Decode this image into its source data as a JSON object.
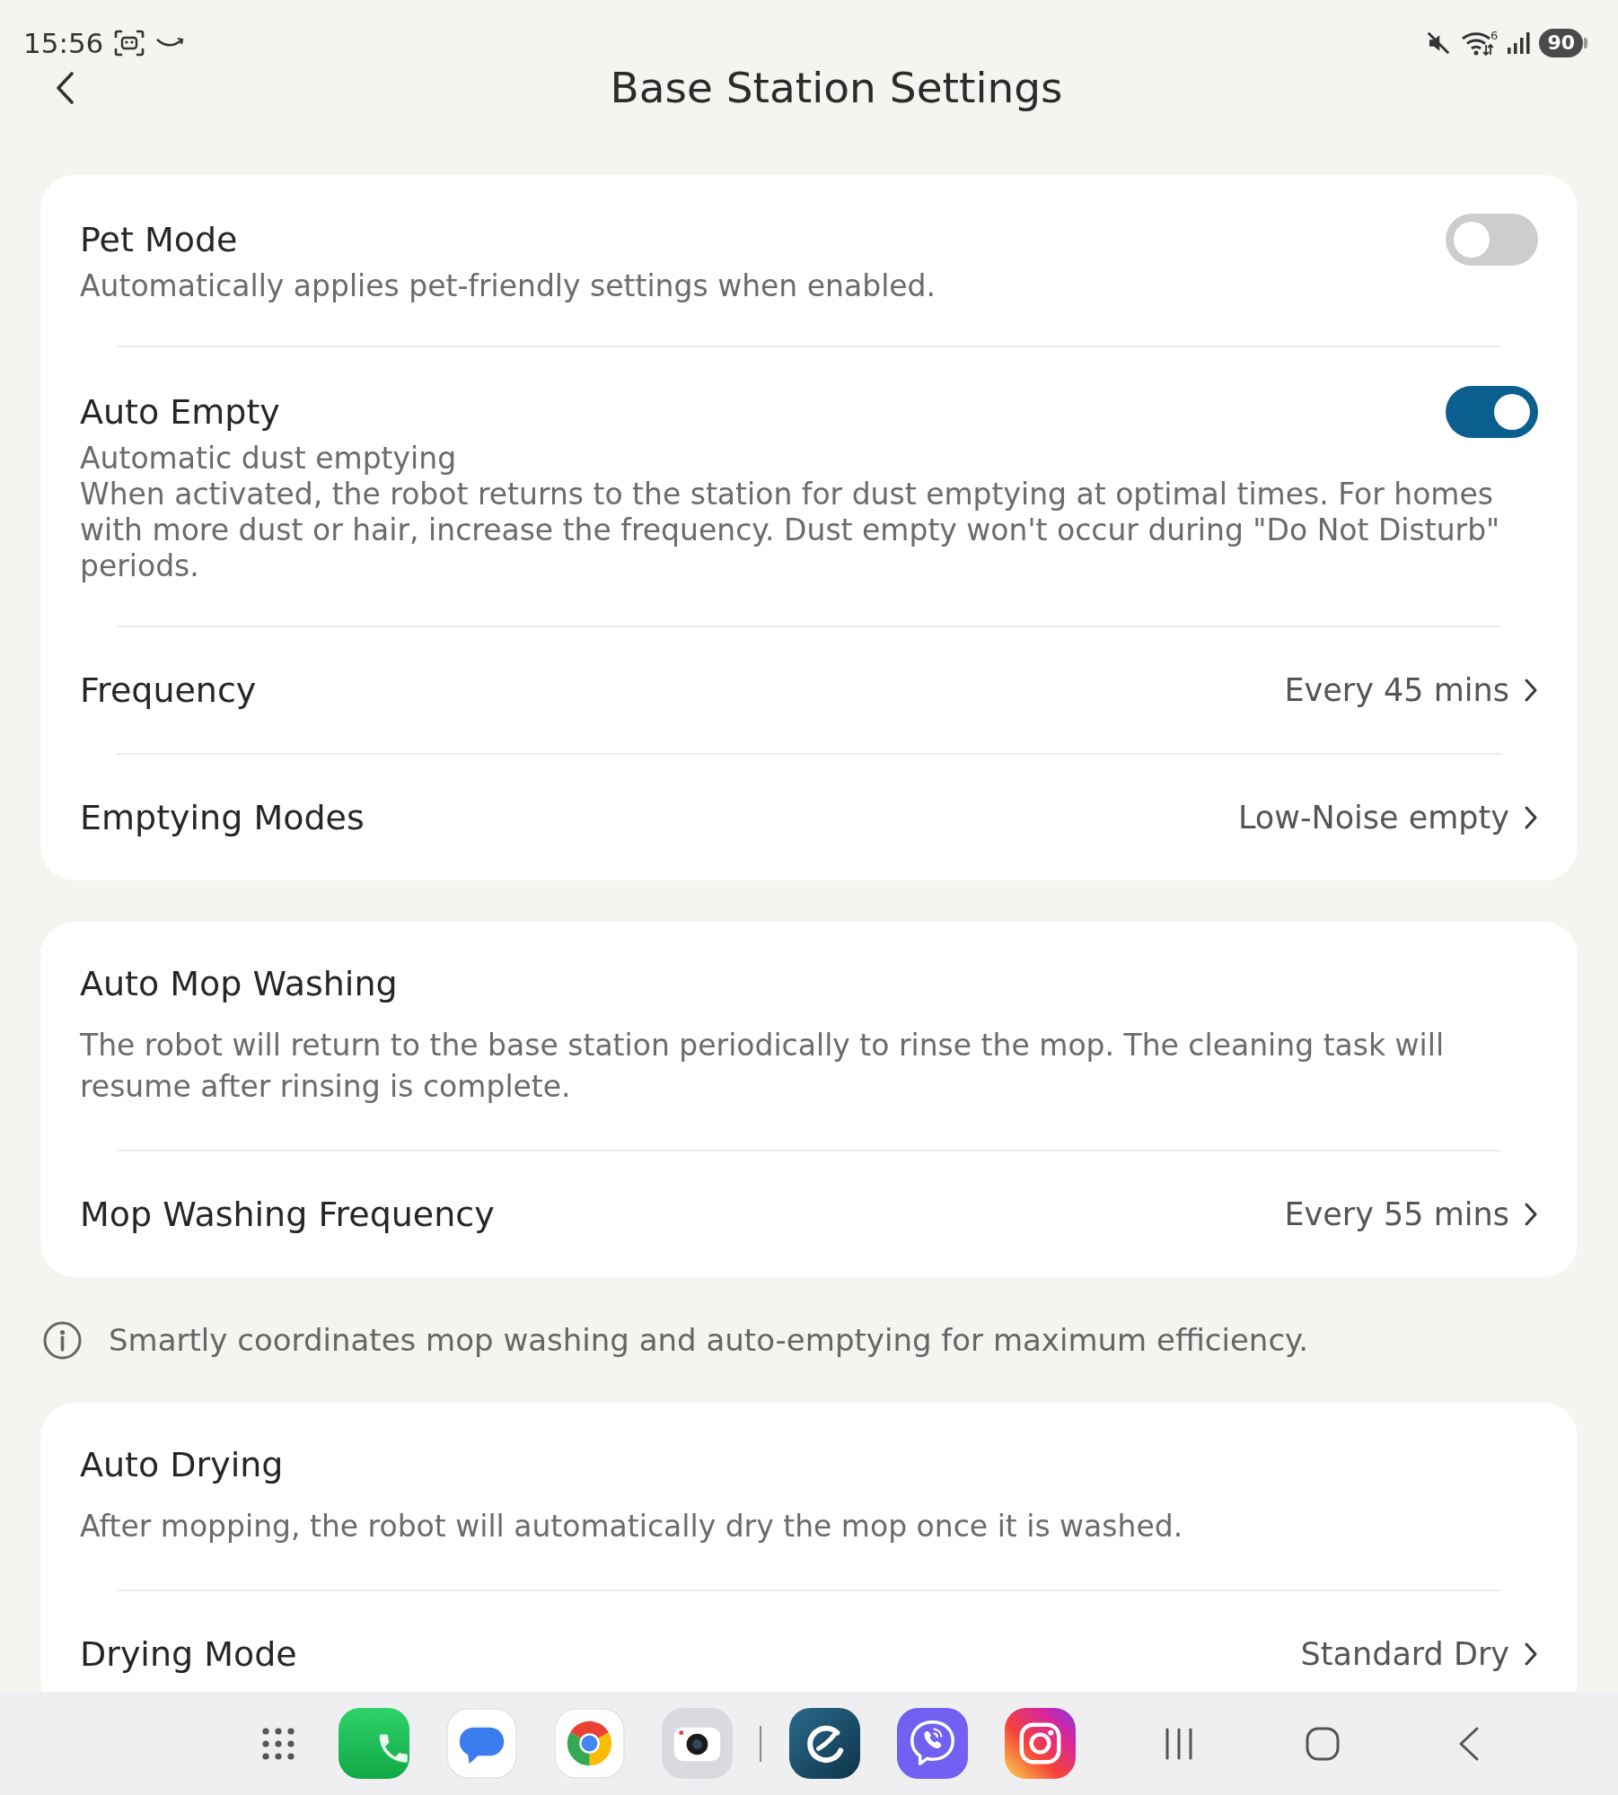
{
  "status_bar": {
    "time": "15:56",
    "wifi_badge": "6",
    "battery": "90"
  },
  "header": {
    "title": "Base Station Settings"
  },
  "sections": [
    {
      "kind": "card",
      "rows": [
        {
          "kind": "toggle",
          "title": "Pet Mode",
          "lines": [
            "Automatically applies pet-friendly settings when enabled."
          ],
          "on": false
        },
        {
          "kind": "toggle",
          "title": "Auto Empty",
          "lines": [
            "Automatic dust emptying",
            "When activated, the robot returns to the station for dust emptying at optimal times. For homes with more dust or hair, increase the frequency. Dust empty won't occur during \"Do Not Disturb\" periods."
          ],
          "on": true
        },
        {
          "kind": "link",
          "title": "Frequency",
          "value": "Every 45 mins"
        },
        {
          "kind": "link",
          "title": "Emptying Modes",
          "value": "Low-Noise empty"
        }
      ]
    },
    {
      "kind": "card",
      "rows": [
        {
          "kind": "info",
          "title": "Auto Mop Washing",
          "lines": [
            "The robot will return to the base station periodically to rinse the mop. The cleaning task will resume after rinsing is complete."
          ]
        },
        {
          "kind": "link",
          "title": "Mop Washing Frequency",
          "value": "Every 55 mins"
        }
      ]
    },
    {
      "kind": "note",
      "text": "Smartly coordinates mop washing and auto-emptying for maximum efficiency."
    },
    {
      "kind": "card",
      "rows": [
        {
          "kind": "info",
          "title": "Auto Drying",
          "lines": [
            "After mopping, the robot will automatically dry the mop once it is washed."
          ]
        },
        {
          "kind": "link",
          "title": "Drying Mode",
          "value": "Standard Dry"
        }
      ]
    }
  ]
}
